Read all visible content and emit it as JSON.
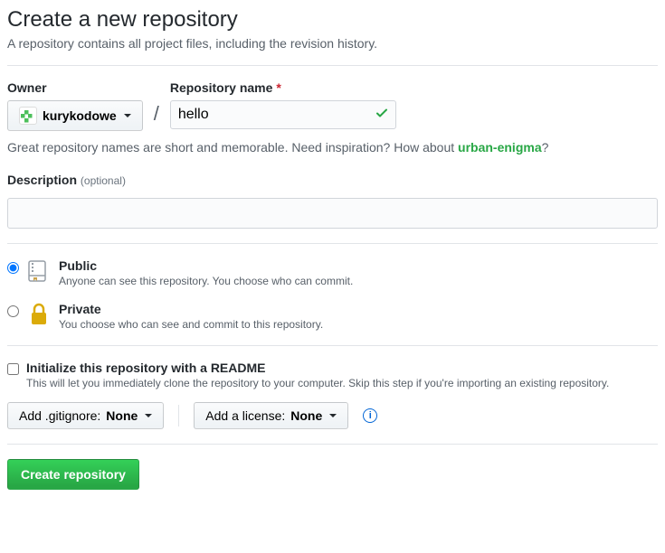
{
  "header": {
    "title": "Create a new repository",
    "subtitle": "A repository contains all project files, including the revision history."
  },
  "owner": {
    "label": "Owner",
    "value": "kurykodowe"
  },
  "repo": {
    "label": "Repository name",
    "value": "hello"
  },
  "hint": {
    "prefix": "Great repository names are short and memorable. Need inspiration? How about ",
    "suggestion": "urban-enigma",
    "suffix": "?"
  },
  "description": {
    "label": "Description",
    "optional": "(optional)",
    "value": ""
  },
  "visibility": {
    "public": {
      "title": "Public",
      "sub": "Anyone can see this repository. You choose who can commit."
    },
    "private": {
      "title": "Private",
      "sub": "You choose who can see and commit to this repository."
    }
  },
  "readme": {
    "title": "Initialize this repository with a README",
    "sub": "This will let you immediately clone the repository to your computer. Skip this step if you're importing an existing repository."
  },
  "gitignore": {
    "prefix": "Add .gitignore: ",
    "value": "None"
  },
  "license": {
    "prefix": "Add a license: ",
    "value": "None"
  },
  "submit": {
    "label": "Create repository"
  }
}
